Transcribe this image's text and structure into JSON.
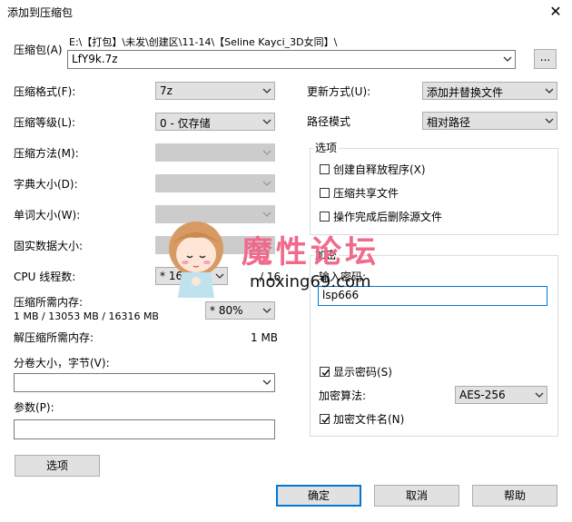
{
  "window": {
    "title": "添加到压缩包",
    "close_label": "✕"
  },
  "archive": {
    "label": "压缩包(A)",
    "path": "E:\\【打包】\\未发\\创建区\\11-14\\【Seline  Kayci_3D女同】\\",
    "name": "LfY9k.7z",
    "browse_label": "..."
  },
  "left_fields": {
    "format": {
      "label": "压缩格式(F):",
      "value": "7z"
    },
    "level": {
      "label": "压缩等级(L):",
      "value": "0 - 仅存储"
    },
    "method": {
      "label": "压缩方法(M):",
      "value": ""
    },
    "dict": {
      "label": "字典大小(D):",
      "value": ""
    },
    "word": {
      "label": "单词大小(W):",
      "value": ""
    },
    "solid": {
      "label": "固实数据大小:",
      "value": ""
    },
    "threads": {
      "label": "CPU 线程数:",
      "value": "* 16",
      "max": "/ 16"
    },
    "memory": {
      "label": "压缩所需内存:",
      "stats": "1 MB / 13053 MB / 16316 MB",
      "value": "* 80%"
    },
    "decomp": {
      "label": "解压缩所需内存:",
      "value": "1 MB"
    },
    "volume": {
      "label": "分卷大小，字节(V):",
      "value": ""
    },
    "params": {
      "label": "参数(P):",
      "value": ""
    },
    "options_button": "选项"
  },
  "right_fields": {
    "update": {
      "label": "更新方式(U):",
      "value": "添加并替换文件"
    },
    "path_mode": {
      "label": "路径模式",
      "value": "相对路径"
    },
    "options_group": {
      "legend": "选项",
      "sfx": "创建自释放程序(X)",
      "shared": "压缩共享文件",
      "delete": "操作完成后删除源文件"
    },
    "encryption": {
      "legend": "加密",
      "password_label": "输入密码:",
      "password": "lsp666",
      "show_password": "显示密码(S)",
      "method_label": "加密算法:",
      "method": "AES-256",
      "encrypt_names": "加密文件名(N)"
    }
  },
  "footer": {
    "ok": "确定",
    "cancel": "取消",
    "help": "帮助"
  },
  "watermark": {
    "title": "魔性论坛",
    "url": "moxing69.com"
  }
}
